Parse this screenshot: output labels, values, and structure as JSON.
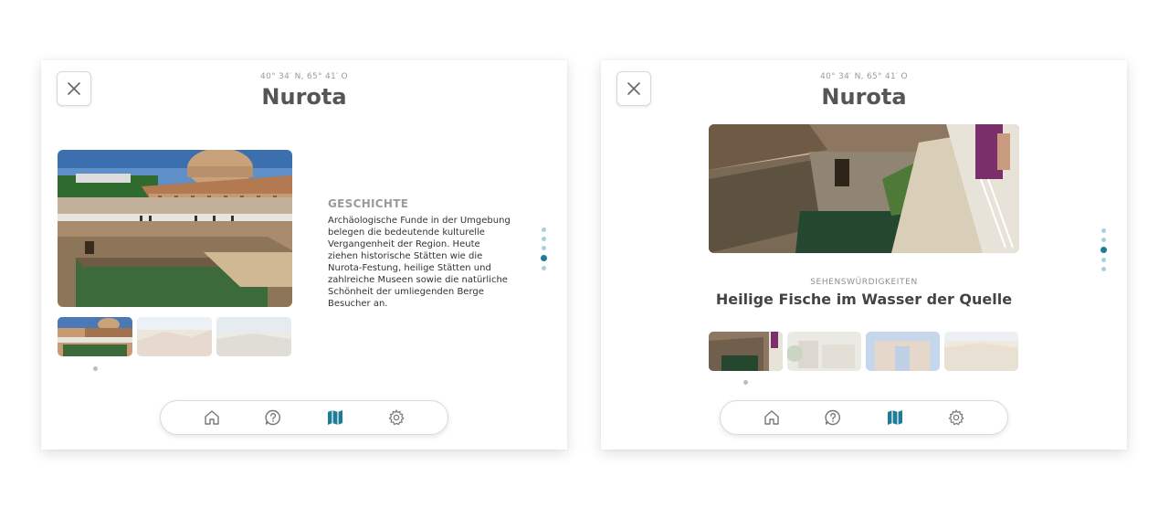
{
  "colors": {
    "accent": "#1d7d96",
    "pager_inactive": "#a9d0db",
    "icon_default": "#777777"
  },
  "left_card": {
    "coords": "40° 34′ N, 65° 41′ O",
    "title": "Nurota",
    "section_heading": "GESCHICHTE",
    "section_text": "Archäologische Funde in der Umgebung belegen die bedeutende kulturelle Vergangenheit der Region. Heute ziehen historische Stätten wie die Nurota-Festung, heilige Stätten und zahlreiche Museen sowie die natürliche Schönheit der umliegenden Berge Besucher an.",
    "thumbnail_count": 3,
    "active_thumbnail": 1,
    "pager": {
      "total": 5,
      "active": 4
    }
  },
  "right_card": {
    "coords": "40° 34′ N, 65° 41′ O",
    "title": "Nurota",
    "caption_kicker": "SEHENSWÜRDIGKEITEN",
    "caption_title": "Heilige Fische im Wasser der Quelle",
    "thumbnail_count": 4,
    "active_thumbnail": 1,
    "pager": {
      "total": 5,
      "active": 3
    }
  },
  "nav_icons": [
    "home-icon",
    "help-icon",
    "map-icon",
    "settings-icon"
  ],
  "active_nav": "map-icon",
  "close_icon": "close-icon"
}
